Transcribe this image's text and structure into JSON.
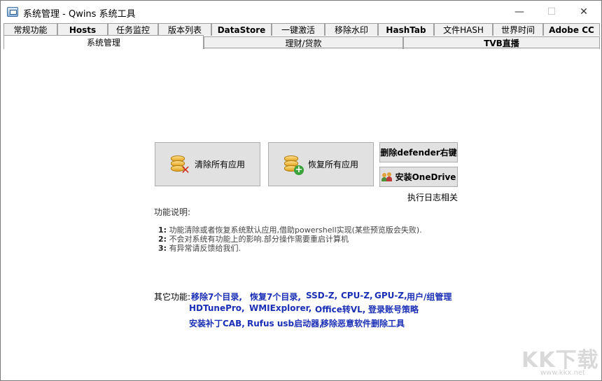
{
  "window": {
    "title": "系统管理 - Qwins 系统工具",
    "minimize": "—",
    "maximize": "☐",
    "close": "✕"
  },
  "tabs_row1": [
    {
      "label": "常规功能",
      "bold": false
    },
    {
      "label": "Hosts",
      "bold": true
    },
    {
      "label": "任务监控",
      "bold": false
    },
    {
      "label": "版本列表",
      "bold": false
    },
    {
      "label": "DataStore",
      "bold": true
    },
    {
      "label": "一键激活",
      "bold": false
    },
    {
      "label": "移除水印",
      "bold": false
    },
    {
      "label": "HashTab",
      "bold": true
    },
    {
      "label": "文件HASH",
      "bold": false
    },
    {
      "label": "世界时间",
      "bold": false
    },
    {
      "label": "Adobe CC",
      "bold": true
    }
  ],
  "tabs_row2": [
    {
      "label": "系统管理",
      "active": true
    },
    {
      "label": "理财/贷款",
      "active": false
    },
    {
      "label": "TVB直播",
      "active": false
    }
  ],
  "buttons": {
    "remove_all": "清除所有应用",
    "restore_all": "恢复所有应用",
    "delete_defender": "删除defender右键",
    "install_onedrive": "安装OneDrive"
  },
  "log_label": "执行日志相关",
  "description": {
    "title": "功能说明:",
    "lines": [
      {
        "num": "1:",
        "text": "功能清除或者恢复系统默认应用,借助powershell实现(某些预览版会失败)."
      },
      {
        "num": "2:",
        "text": "不会对系统有功能上的影响.部分操作需要重启计算机"
      },
      {
        "num": "3:",
        "text": "有异常请反馈给我们."
      }
    ]
  },
  "other": {
    "label": "其它功能:",
    "links": {
      "move7": "移除7个目录,",
      "restore7": "恢复7个目录,",
      "ssdz": "SSD-Z,",
      "cpuz": "CPU-Z,",
      "gpuz": "GPU-Z,",
      "usergroup": "用户/组管理",
      "hdtune": "HDTunePro,",
      "wmi": "WMIExplorer,",
      "office": "Office转VL,",
      "login": "登录账号策略",
      "cab": "安装补丁CAB,",
      "rufus": "Rufus usb启动器,",
      "malware": "移除恶意软件删除工具"
    }
  },
  "watermark": {
    "logo": "KK下载",
    "url": "www.kkx.net"
  }
}
